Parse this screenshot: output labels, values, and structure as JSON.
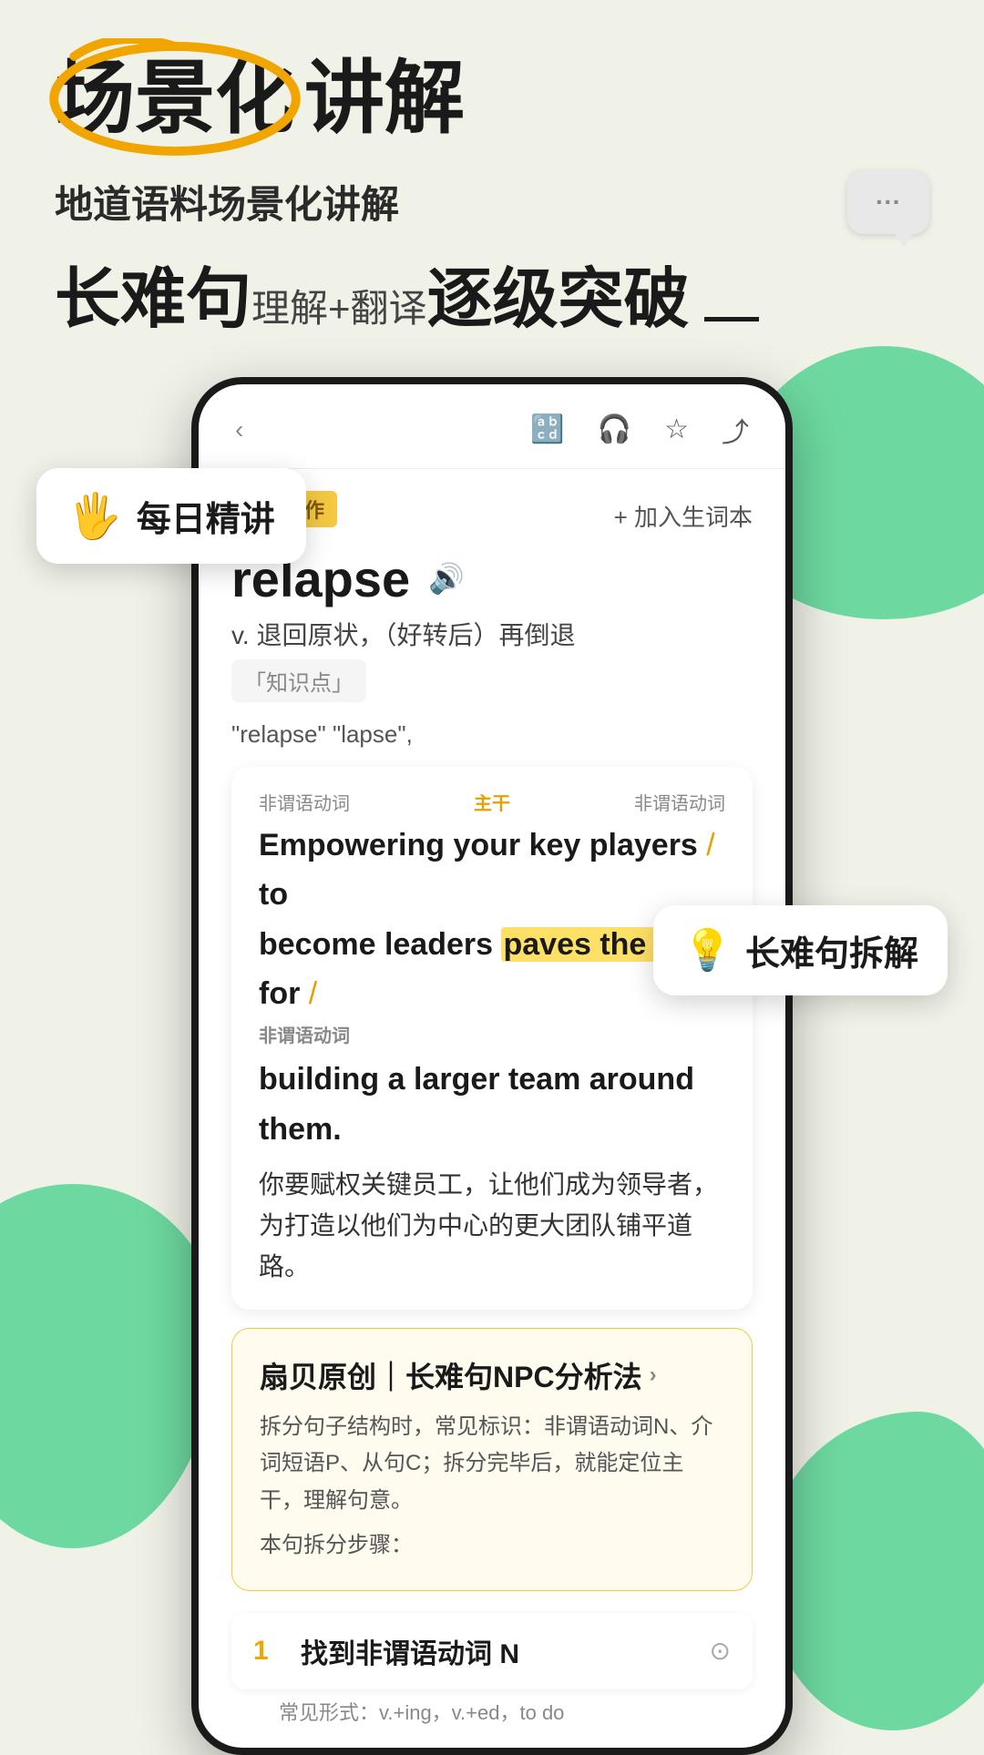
{
  "background_color": "#f0f2e8",
  "accent_green": "#6dd9a0",
  "accent_orange": "#f0a500",
  "hero": {
    "title_part1": "场景化",
    "title_part2": "讲解"
  },
  "subtitle": {
    "line1": "地道语料场景化讲解",
    "line2_large": "长难句",
    "line2_small1": "理解+翻译",
    "line2_large2": "逐级突破"
  },
  "floating_cards": {
    "daily": {
      "icon": "🖐️",
      "label": "每日精讲"
    },
    "sentence": {
      "icon": "💡",
      "label": "长难句拆解"
    }
  },
  "phone": {
    "word_tag": "高频写作",
    "word": "relapse",
    "add_vocab": "+ 加入生词本",
    "definition": "v. 退回原状，（好转后）再倒退",
    "knowledge_link": "「知识点」",
    "example_start": "\"relapse\"",
    "example_end": "\"lapse\",",
    "grammar_labels": {
      "left": "非谓语动词",
      "center": "主干",
      "right": "非谓语动词"
    },
    "sentence_line1": "Empowering your key players / to",
    "sentence_line2": "become leaders",
    "sentence_highlight": "paves the road",
    "sentence_line2_end": "for /",
    "sentence_label": "非谓语动词",
    "sentence_line3": "building a larger team around them.",
    "translation": "你要赋权关键员工，让他们成为领导者，为打造以他们为中心的更大团队铺平道路。",
    "npc_title": "扇贝原创｜长难句NPC分析法",
    "npc_desc1": "拆分句子结构时，常见标识：非谓语动词N、介词短语P、从句C；拆分完毕后，就能定位主干，理解句意。",
    "npc_desc2": "本句拆分步骤：",
    "step1_number": "1",
    "step1_title": "找到非谓语动词 N",
    "step1_icon": "⊙",
    "step1_sub": "常见形式：v.+ing，v.+ed，to do"
  }
}
